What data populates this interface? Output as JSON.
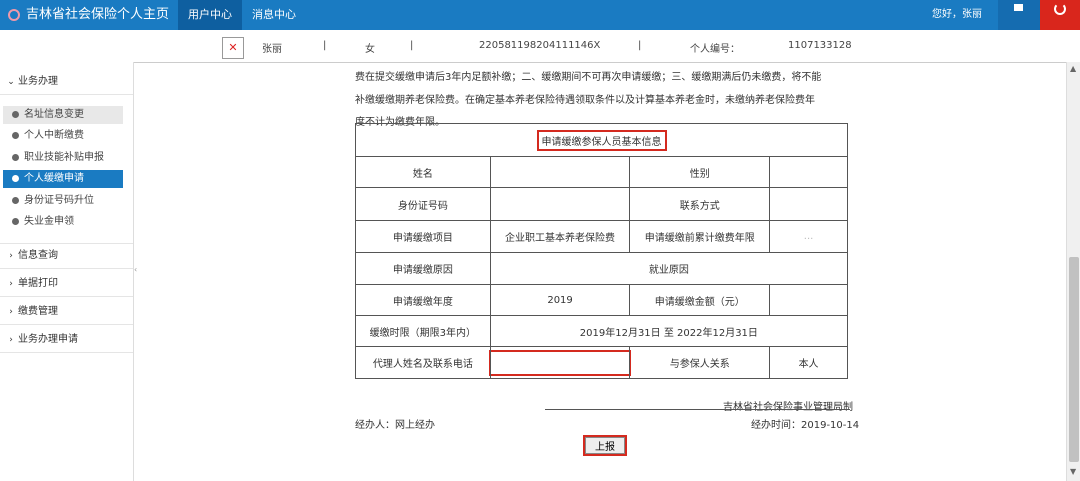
{
  "header": {
    "title": "吉林省社会保险个人主页",
    "nav": [
      "用户中心",
      "消息中心"
    ],
    "greeting": "您好，张丽"
  },
  "userbar": {
    "name": "张丽",
    "sep": "|",
    "gender": "女",
    "id_number": "220581198204111146X",
    "personal_no_label": "个人编号：",
    "personal_no": "1107133128"
  },
  "sidebar": {
    "business": "业务办理",
    "items": [
      "名址信息变更",
      "个人中断缴费",
      "职业技能补贴申报",
      "个人缓缴申请",
      "身份证号码升位",
      "失业金申领"
    ],
    "sections": [
      "信息查询",
      "单据打印",
      "缴费管理",
      "业务办理申请"
    ]
  },
  "notice": [
    "费在提交缓缴申请后3年内足额补缴；二、缓缴期间不可再次申请缓缴；三、缓缴期满后仍未缴费，将不能",
    "补缴缓缴期养老保险费。在确定基本养老保险待遇领取条件以及计算基本养老金时，未缴纳养老保险费年",
    "度不计为缴费年限。"
  ],
  "form": {
    "title": "申请缓缴参保人员基本信息",
    "name_label": "姓名",
    "gender_label": "性别",
    "id_label": "身份证号码",
    "contact_label": "联系方式",
    "item_label": "申请缓缴项目",
    "item_value": "企业职工基本养老保险费",
    "years_label": "申请缓缴前累计缴费年限",
    "years_value": "...",
    "reason_label": "申请缓缴原因",
    "reason_value": "就业原因",
    "year_label": "申请缓缴年度",
    "year_value": "2019",
    "amount_label": "申请缓缴金额（元）",
    "period_label": "缓缴时限（期限3年内）",
    "period_value": "2019年12月31日  至  2022年12月31日",
    "agent_label": "代理人姓名及联系电话",
    "relation_label": "与参保人关系",
    "relation_value": "本人"
  },
  "footer": {
    "org": "吉林省社会保险事业管理局制",
    "handler": "经办人：网上经办",
    "date": "经办时间：2019-10-14",
    "submit": "上报"
  }
}
